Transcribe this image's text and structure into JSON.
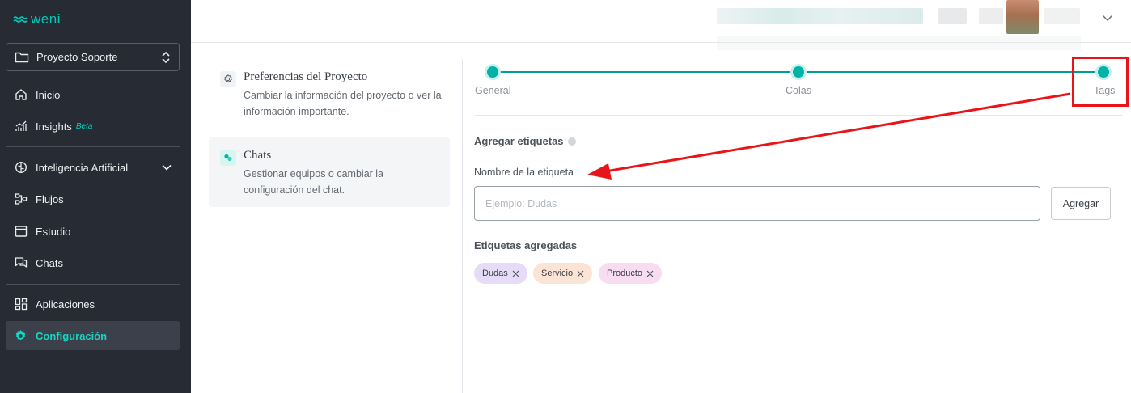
{
  "brand": {
    "name": "weni",
    "accent": "#00c8b8"
  },
  "sidebar": {
    "project": {
      "label": "Proyecto Soporte",
      "icon": "folder-icon"
    },
    "items": [
      {
        "label": "Inicio",
        "icon": "home-icon"
      },
      {
        "label": "Insights",
        "badge": "Beta",
        "icon": "chart-icon"
      },
      {
        "label": "Inteligencia Artificial",
        "icon": "brain-icon"
      },
      {
        "label": "Flujos",
        "icon": "flow-icon"
      },
      {
        "label": "Estudio",
        "icon": "window-icon"
      },
      {
        "label": "Chats",
        "icon": "chat-icon"
      },
      {
        "label": "Aplicaciones",
        "icon": "apps-icon"
      },
      {
        "label": "Configuración",
        "icon": "gear-icon",
        "active": true
      }
    ]
  },
  "settings_menu": [
    {
      "title": "Preferencias del Proyecto",
      "description": "Cambiar la información del proyecto o ver la información importante.",
      "icon": "gear-icon"
    },
    {
      "title": "Chats",
      "description": "Gestionar equipos o cambiar la configuración del chat.",
      "icon": "chat-bubbles-icon",
      "selected": true
    }
  ],
  "stepper": {
    "steps": [
      "General",
      "Colas",
      "Tags"
    ],
    "current": 2
  },
  "tags_section": {
    "title": "Agregar etiquetas",
    "field_label": "Nombre de la etiqueta",
    "placeholder": "Ejemplo: Dudas",
    "value": "",
    "add_button": "Agregar",
    "added_title": "Etiquetas agregadas",
    "chips": [
      {
        "label": "Dudas",
        "color": "#e6dcf7"
      },
      {
        "label": "Servicio",
        "color": "#fbe3d6"
      },
      {
        "label": "Producto",
        "color": "#f8dcf1"
      }
    ]
  },
  "colors": {
    "sidebar_bg": "#272b33",
    "teal": "#00b3a6",
    "annotation_red": "#e8141a"
  }
}
